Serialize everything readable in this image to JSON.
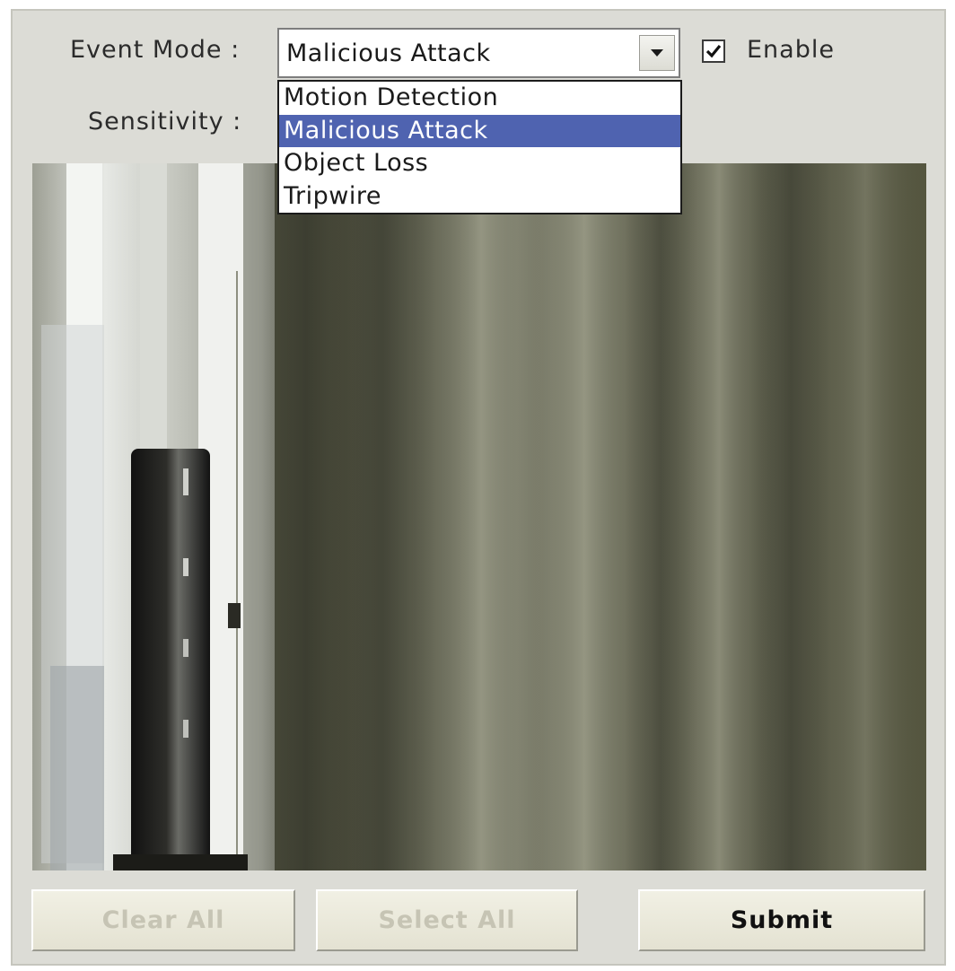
{
  "event_mode": {
    "label": "Event Mode :",
    "selected_value": "Malicious Attack",
    "options": [
      "Motion Detection",
      "Malicious Attack",
      "Object Loss",
      "Tripwire"
    ],
    "selected_index": 1
  },
  "enable": {
    "label": "Enable",
    "checked": true
  },
  "sensitivity": {
    "label": "Sensitivity :"
  },
  "buttons": {
    "clear_all": "Clear All",
    "select_all": "Select All",
    "submit": "Submit"
  },
  "colors": {
    "panel": "#dcdcd6",
    "highlight": "#4f63b0",
    "disabled_text": "#c6c4b4"
  },
  "icons": [
    "chevron-down-icon",
    "checkmark-icon"
  ]
}
